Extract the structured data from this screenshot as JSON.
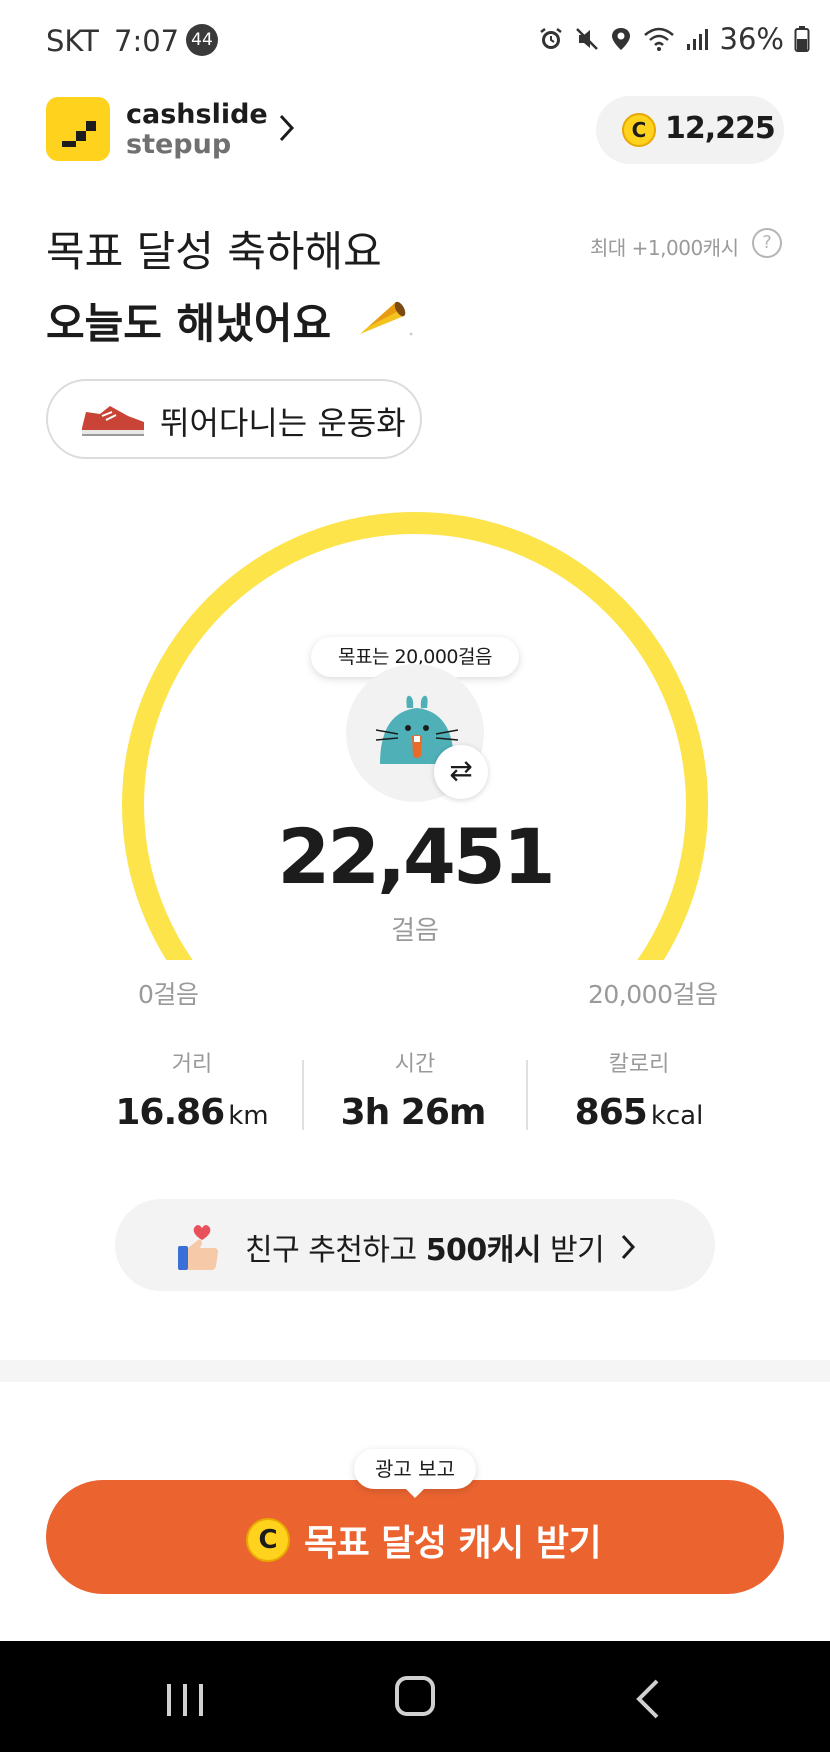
{
  "status_bar": {
    "carrier": "SKT",
    "time": "7:07",
    "notification_count": "44",
    "battery": "36%"
  },
  "header": {
    "brand_line1": "cashslide",
    "brand_line2": "stepup",
    "cash_coin_symbol": "C",
    "cash_balance": "12,225"
  },
  "headline": {
    "line1": "목표 달성 축하해요",
    "line2": "오늘도 해냈어요",
    "max_cash_note": "최대 +1,000캐시",
    "help_symbol": "?"
  },
  "shoe": {
    "label": "뛰어다니는 운동화"
  },
  "gauge": {
    "goal_text": "목표는 20,000걸음",
    "steps": "22,451",
    "steps_unit": "걸음",
    "min_label": "0걸음",
    "max_label": "20,000걸음",
    "progress_fraction": 1.0,
    "track_color": "#fde44a"
  },
  "stats": [
    {
      "label": "거리",
      "value": "16.86",
      "unit": "km"
    },
    {
      "label": "시간",
      "value": "3h 26m",
      "unit": ""
    },
    {
      "label": "칼로리",
      "value": "865",
      "unit": "kcal"
    }
  ],
  "invite": {
    "prefix": "친구 추천하고 ",
    "highlight": "500캐시",
    "suffix": " 받기"
  },
  "cta": {
    "bubble": "광고 보고",
    "coin_symbol": "C",
    "label": "목표 달성 캐시 받기",
    "color": "#eb6430"
  },
  "colors": {
    "brand_yellow": "#ffd21e",
    "gauge_yellow": "#fde44a",
    "cta_orange": "#eb6430"
  },
  "icons": {
    "swap": "swap-arrows-icon",
    "invite": "thumbs-up-heart-icon",
    "shoe": "sneaker-icon",
    "character": "rabbit-character-icon"
  }
}
